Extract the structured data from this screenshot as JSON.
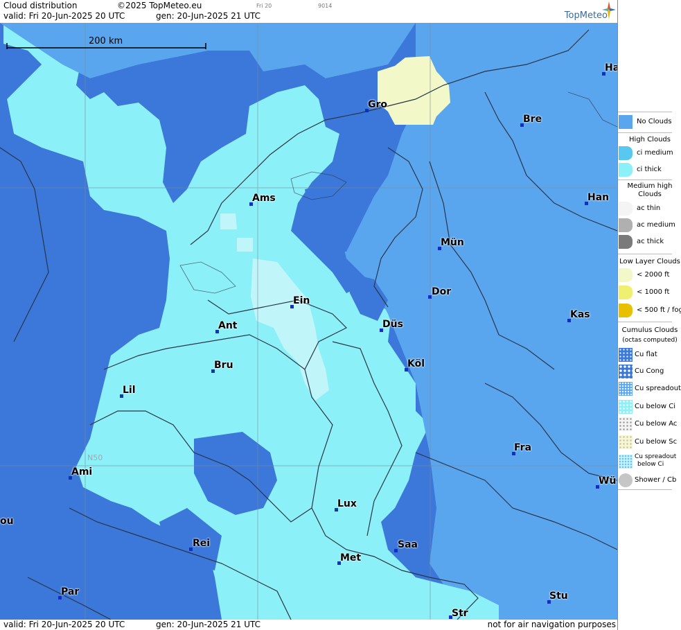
{
  "header": {
    "title": "Cloud distribution",
    "copyright": "©2025 TopMeteo.eu",
    "tiny_date": "Fri 20",
    "tiny_code": "9014",
    "valid_line": "valid:  Fri  20-Jun-2025  20 UTC",
    "gen_line": "gen: 20-Jun-2025 21 UTC",
    "logo": "TopMeteo"
  },
  "map": {
    "scale_label": "200 km",
    "lat_label": "N50",
    "cities": [
      {
        "id": "ha",
        "name": "Ha"
      },
      {
        "id": "gro",
        "name": "Gro"
      },
      {
        "id": "bre",
        "name": "Bre"
      },
      {
        "id": "ams",
        "name": "Ams"
      },
      {
        "id": "han",
        "name": "Han"
      },
      {
        "id": "mun",
        "name": "Mün"
      },
      {
        "id": "ein",
        "name": "Ein"
      },
      {
        "id": "dor",
        "name": "Dor"
      },
      {
        "id": "kas",
        "name": "Kas"
      },
      {
        "id": "ant",
        "name": "Ant"
      },
      {
        "id": "dus",
        "name": "Düs"
      },
      {
        "id": "bru",
        "name": "Bru"
      },
      {
        "id": "kol",
        "name": "Köl"
      },
      {
        "id": "lil",
        "name": "Lil"
      },
      {
        "id": "fra",
        "name": "Fra"
      },
      {
        "id": "ami",
        "name": "Ami"
      },
      {
        "id": "wu",
        "name": "Wü"
      },
      {
        "id": "lux",
        "name": "Lux"
      },
      {
        "id": "ou",
        "name": "ou"
      },
      {
        "id": "rei",
        "name": "Rei"
      },
      {
        "id": "saa",
        "name": "Saa"
      },
      {
        "id": "met",
        "name": "Met"
      },
      {
        "id": "par",
        "name": "Par"
      },
      {
        "id": "stu",
        "name": "Stu"
      },
      {
        "id": "str",
        "name": "Str"
      }
    ]
  },
  "footer": {
    "valid_line": "valid:  Fri  20-Jun-2025  20 UTC",
    "gen_line": "gen: 20-Jun-2025 21 UTC",
    "note": "not for air navigation purposes"
  },
  "legend": {
    "no_clouds": "No Clouds",
    "high_head": "High Clouds",
    "ci_medium": "ci medium",
    "ci_thick": "ci thick",
    "medium_head": "Medium high Clouds",
    "ac_thin": "ac thin",
    "ac_medium": "ac medium",
    "ac_thick": "ac thick",
    "low_head": "Low Layer Clouds",
    "low_2000": "< 2000 ft",
    "low_1000": "< 1000 ft",
    "low_500": "< 500 ft / fog",
    "cu_head": "Cumulus Clouds",
    "cu_sub": "(octas computed)",
    "cu_flat": "Cu flat",
    "cu_cong": "Cu Cong",
    "cu_spread": "Cu spreadout",
    "cu_below_ci": "Cu below Ci",
    "cu_below_ac": "Cu below Ac",
    "cu_below_sc": "Cu below Sc",
    "cu_spread_ci_1": "Cu spreadout",
    "cu_spread_ci_2": "below Ci",
    "shower": "Shower / Cb"
  },
  "colors": {
    "no_clouds": "#3b78d9",
    "ci_medium": "#59c8f0",
    "ci_thick": "#8cf0f8",
    "ac_thin": "#c0f6fa",
    "low_2000": "#f2f8c8",
    "low_500": "#e8c000"
  }
}
